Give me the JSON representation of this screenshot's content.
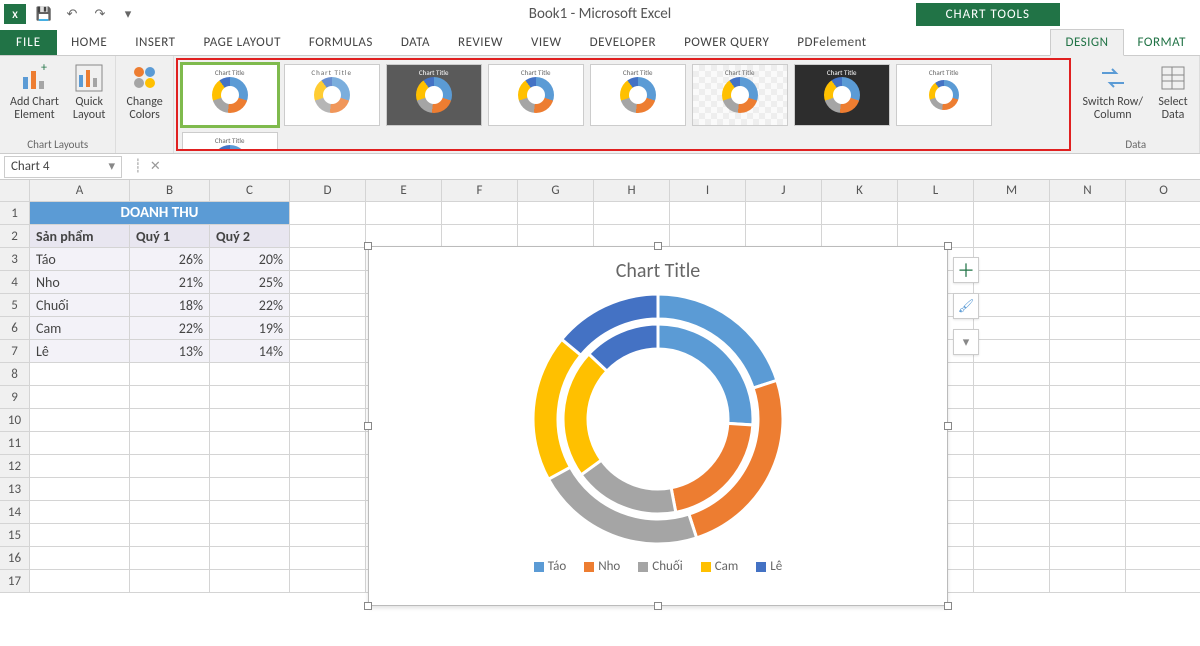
{
  "window_title": "Book1 - Microsoft Excel",
  "chart_tools_label": "CHART TOOLS",
  "tabs": {
    "file": "FILE",
    "home": "HOME",
    "insert": "INSERT",
    "page_layout": "PAGE LAYOUT",
    "formulas": "FORMULAS",
    "data": "DATA",
    "review": "REVIEW",
    "view": "VIEW",
    "developer": "DEVELOPER",
    "power_query": "POWER QUERY",
    "pdfelement": "PDFelement",
    "design": "DESIGN",
    "format": "FORMAT"
  },
  "ribbon": {
    "chart_layouts": {
      "add_chart_element": "Add Chart\nElement",
      "quick_layout": "Quick\nLayout",
      "group_label": "Chart Layouts"
    },
    "change_colors": "Change\nColors",
    "switch_row_col": "Switch Row/\nColumn",
    "select_data": "Select\nData",
    "data_group_label": "Data",
    "style_mini_title": "Chart Title"
  },
  "namebox": "Chart 4",
  "columns": [
    "A",
    "B",
    "C",
    "D",
    "E",
    "F",
    "G",
    "H",
    "I",
    "J",
    "K",
    "L",
    "M",
    "N",
    "O"
  ],
  "row_count": 17,
  "table": {
    "title": "DOANH THU",
    "headers": [
      "Sản phẩm",
      "Quý 1",
      "Quý 2"
    ],
    "rows": [
      {
        "name": "Táo",
        "q1": "26%",
        "q2": "20%"
      },
      {
        "name": "Nho",
        "q1": "21%",
        "q2": "25%"
      },
      {
        "name": "Chuối",
        "q1": "18%",
        "q2": "22%"
      },
      {
        "name": "Cam",
        "q1": "22%",
        "q2": "19%"
      },
      {
        "name": "Lê",
        "q1": "13%",
        "q2": "14%"
      }
    ]
  },
  "chart_title": "Chart Title",
  "legend": [
    "Táo",
    "Nho",
    "Chuối",
    "Cam",
    "Lê"
  ],
  "colors": {
    "c1": "#5b9bd5",
    "c2": "#ed7d31",
    "c3": "#a5a5a5",
    "c4": "#ffc000",
    "c5": "#4472c4"
  },
  "chart_data": {
    "type": "pie",
    "title": "Chart Title",
    "categories": [
      "Táo",
      "Nho",
      "Chuối",
      "Cam",
      "Lê"
    ],
    "series": [
      {
        "name": "Quý 1",
        "values": [
          26,
          21,
          18,
          22,
          13
        ]
      },
      {
        "name": "Quý 2",
        "values": [
          20,
          25,
          22,
          19,
          14
        ]
      }
    ]
  }
}
